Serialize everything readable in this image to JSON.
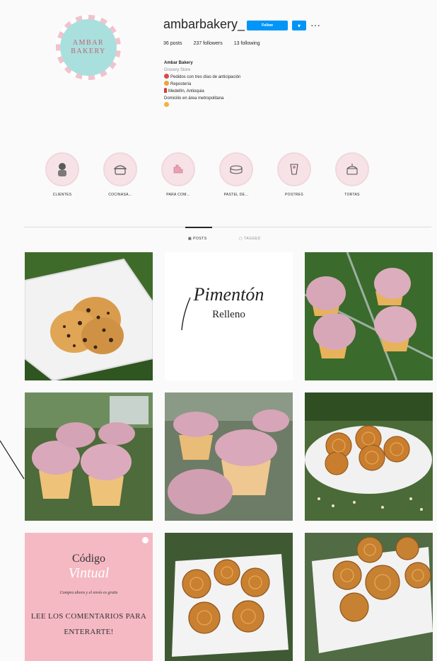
{
  "profile": {
    "avatar_text_line1": "AMBAR",
    "avatar_text_line2": "BAKERY",
    "username": "ambarbakery_",
    "follow_label": "Follow",
    "stats": {
      "posts": "36 posts",
      "followers": "237 followers",
      "following": "13 following"
    },
    "bio": {
      "name": "Ambar Bakery",
      "category": "Grocery Store",
      "lines": [
        "Pedidos con tres días de anticipación",
        "Repostería",
        "Medellín, Antioquia",
        "Domicilio en área metropolitana"
      ]
    }
  },
  "highlights": [
    {
      "label": "CLIENTES",
      "icon": "client-icon"
    },
    {
      "label": "COCINASA...",
      "icon": "cooking-pot-icon"
    },
    {
      "label": "PARA COM...",
      "icon": "hand-icon"
    },
    {
      "label": "PASTEL DE...",
      "icon": "cake-icon"
    },
    {
      "label": "POSTRES",
      "icon": "dessert-icon"
    },
    {
      "label": "TORTAS",
      "icon": "torta-icon"
    }
  ],
  "tabs": {
    "posts_label": "POSTS",
    "tagged_label": "TAGGED"
  },
  "posts": {
    "pimenton_title": "Pimentón",
    "pimenton_subtitle": "Relleno",
    "codigo_title": "Código",
    "codigo_script": "Vintual",
    "codigo_small": "Compra ahora y el envío es gratis",
    "codigo_cta_line1": "LEE LOS COMENTARIOS PARA",
    "codigo_cta_line2": "ENTERARTE!"
  },
  "colors": {
    "accent": "#0095f6",
    "avatar_bg": "#a9e0dd",
    "avatar_text": "#c0637a",
    "pink_tile": "#f5b9c3",
    "frosting": "#d9a9bb"
  }
}
